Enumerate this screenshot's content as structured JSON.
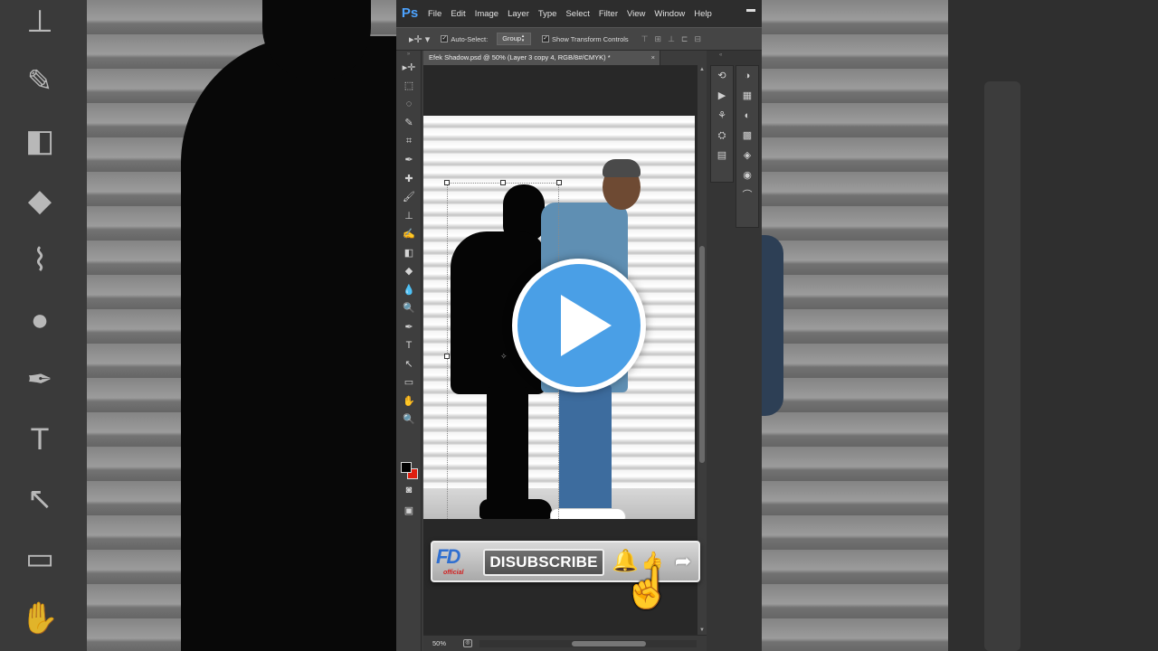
{
  "app": {
    "logo": "Ps",
    "menu": [
      "File",
      "Edit",
      "Image",
      "Layer",
      "Type",
      "Select",
      "Filter",
      "View",
      "Window",
      "Help"
    ],
    "minimize_glyph": "▬"
  },
  "options_bar": {
    "tool_icon": "move-tool-icon",
    "auto_select_label": "Auto-Select:",
    "auto_select_checked": true,
    "auto_select_value": "Group",
    "show_transform_label": "Show Transform Controls",
    "show_transform_checked": true
  },
  "document": {
    "tab_title": "Efek Shadow.psd @ 50% (Layer 3 copy 4, RGB/8#/CMYK) *",
    "close_glyph": "×"
  },
  "status": {
    "zoom": "50%"
  },
  "tools": [
    "move-tool-icon",
    "marquee-tool-icon",
    "lasso-tool-icon",
    "quick-select-tool-icon",
    "crop-tool-icon",
    "eyedropper-tool-icon",
    "healing-tool-icon",
    "brush-tool-icon",
    "stamp-tool-icon",
    "history-brush-tool-icon",
    "eraser-tool-icon",
    "paint-bucket-tool-icon",
    "blur-tool-icon",
    "dodge-tool-icon",
    "pen-tool-icon",
    "type-tool-icon",
    "path-select-tool-icon",
    "rectangle-tool-icon",
    "hand-tool-icon",
    "zoom-tool-icon"
  ],
  "tool_glyphs": [
    "▸✛",
    "⬚",
    "◌",
    "✎",
    "⌗",
    "✒",
    "✚",
    "🖌",
    "⊥",
    "✍",
    "◧",
    "◆",
    "💧",
    "🔍",
    "✒",
    "T",
    "↖",
    "▭",
    "✋",
    "🔍"
  ],
  "colors": {
    "foreground": "#000000",
    "background": "#e01f10",
    "play_button": "#4a9fe6",
    "bell": "#e02a1a"
  },
  "overlay": {
    "play_icon": "play-icon",
    "subscribe_label": "DISUBSCRIBE",
    "channel_logo_main": "FD",
    "channel_logo_sub": "official",
    "bell_glyph": "🔔",
    "like_glyph": "👍",
    "share_glyph": "➦",
    "hand_glyph": "☝"
  },
  "panels": {
    "column1": [
      "history-icon",
      "actions-icon",
      "brush-preset-icon",
      "clone-source-icon",
      "tool-presets-icon"
    ],
    "column2": [
      "color-icon",
      "swatches-icon",
      "adjustments-icon",
      "styles-icon",
      "layers-icon",
      "channels-icon",
      "paths-icon"
    ],
    "column1_glyphs": [
      "⟲",
      "▶",
      "⚘",
      "⛭",
      "▤"
    ],
    "column2_glyphs": [
      "◑",
      "▦",
      "◐",
      "▩",
      "◈",
      "◉",
      "⌒"
    ]
  }
}
